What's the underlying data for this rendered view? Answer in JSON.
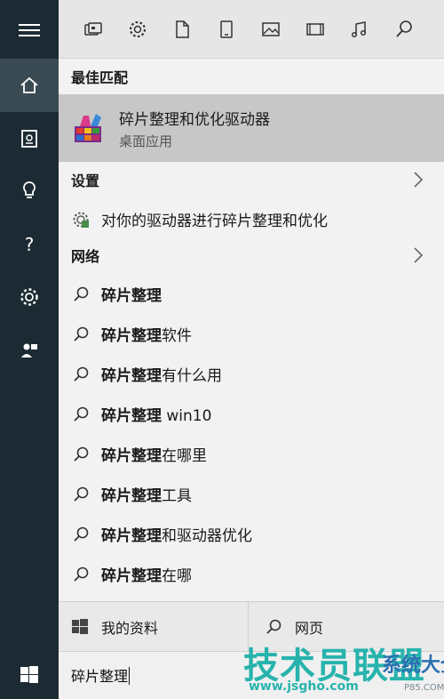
{
  "topbar": {
    "filters": [
      "apps-icon",
      "settings-icon",
      "document-icon",
      "tablet-icon",
      "photo-icon",
      "video-icon",
      "music-icon",
      "search-icon"
    ]
  },
  "rail": {
    "items": [
      "hamburger-icon",
      "home-icon",
      "notebook-icon",
      "lightbulb-icon",
      "help-icon",
      "gear-icon",
      "feedback-icon"
    ]
  },
  "best_match": {
    "header": "最佳匹配",
    "title": "碎片整理和优化驱动器",
    "subtitle": "桌面应用"
  },
  "settings": {
    "header": "设置",
    "item": "对你的驱动器进行碎片整理和优化"
  },
  "web": {
    "header": "网络",
    "suggestions": [
      {
        "bold": "碎片整理",
        "rest": ""
      },
      {
        "bold": "碎片整理",
        "rest": "软件"
      },
      {
        "bold": "碎片整理",
        "rest": "有什么用"
      },
      {
        "bold": "碎片整理",
        "rest": " win10"
      },
      {
        "bold": "碎片整理",
        "rest": "在哪里"
      },
      {
        "bold": "碎片整理",
        "rest": "工具"
      },
      {
        "bold": "碎片整理",
        "rest": "和驱动器优化"
      },
      {
        "bold": "碎片整理",
        "rest": "在哪"
      }
    ]
  },
  "bottom_tabs": {
    "my_stuff": "我的资料",
    "web": "网页"
  },
  "search": {
    "value": "碎片整理"
  },
  "watermark": {
    "main": "技术员联盟",
    "side": "系统大全",
    "url": "www.jsgho.com",
    "url2": "P85.COM"
  },
  "colors": {
    "rail": "#1c2b33",
    "highlight": "#c7c7c7",
    "watermark_teal": "#27b3ad"
  }
}
